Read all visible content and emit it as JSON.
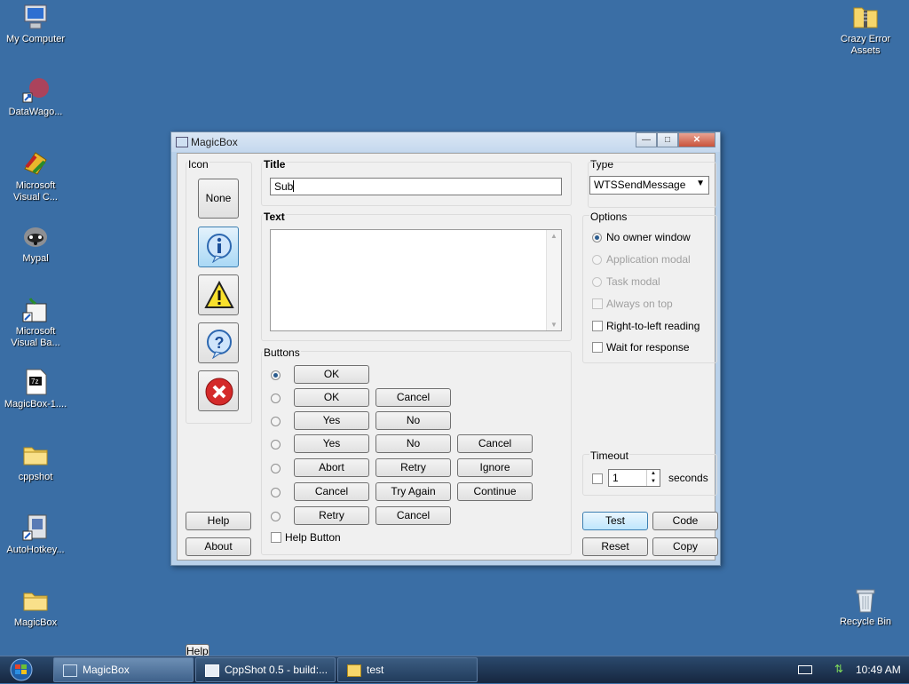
{
  "desktop": {
    "icons": [
      {
        "label": "My Computer",
        "icon": "computer-icon"
      },
      {
        "label": "DataWago...",
        "icon": "app-shortcut-icon"
      },
      {
        "label": "Microsoft Visual C...",
        "icon": "visual-c-icon"
      },
      {
        "label": "Mypal",
        "icon": "raccoon-icon"
      },
      {
        "label": "Microsoft Visual Ba...",
        "icon": "visual-basic-icon"
      },
      {
        "label": "MagicBox-1....",
        "icon": "7z-archive-icon"
      },
      {
        "label": "cppshot",
        "icon": "folder-icon"
      },
      {
        "label": "AutoHotkey...",
        "icon": "autohotkey-icon"
      },
      {
        "label": "MagicBox",
        "icon": "folder-icon"
      },
      {
        "label": "Crazy Error Assets",
        "icon": "zip-folder-icon"
      },
      {
        "label": "Recycle Bin",
        "icon": "recycle-bin-icon"
      }
    ]
  },
  "window": {
    "title": "MagicBox",
    "icon_section": {
      "label": "Icon",
      "none_label": "None",
      "icons": [
        "information-icon",
        "warning-icon",
        "question-icon",
        "error-icon"
      ],
      "selected": "information-icon"
    },
    "title_field": {
      "label": "Title",
      "value": "Sub"
    },
    "text_field": {
      "label": "Text",
      "value": ""
    },
    "type": {
      "label": "Type",
      "selected": "WTSSendMessage"
    },
    "options": {
      "label": "Options",
      "radios": [
        {
          "label": "No owner window",
          "checked": true,
          "enabled": true
        },
        {
          "label": "Application modal",
          "checked": false,
          "enabled": false
        },
        {
          "label": "Task modal",
          "checked": false,
          "enabled": false
        }
      ],
      "checks": [
        {
          "label": "Always on top",
          "checked": false,
          "enabled": false
        },
        {
          "label": "Right-to-left reading",
          "checked": false,
          "enabled": true
        },
        {
          "label": "Wait for response",
          "checked": false,
          "enabled": true
        }
      ]
    },
    "buttons_section": {
      "label": "Buttons",
      "rows": [
        [
          "OK"
        ],
        [
          "OK",
          "Cancel"
        ],
        [
          "Yes",
          "No"
        ],
        [
          "Yes",
          "No",
          "Cancel"
        ],
        [
          "Abort",
          "Retry",
          "Ignore"
        ],
        [
          "Cancel",
          "Try Again",
          "Continue"
        ],
        [
          "Retry",
          "Cancel"
        ]
      ],
      "selected_row": 0,
      "help_button_label": "Help Button"
    },
    "timeout": {
      "label": "Timeout",
      "value": "1",
      "unit": "seconds"
    },
    "actions": {
      "help": "Help",
      "about": "About",
      "test": "Test",
      "code": "Code",
      "reset": "Reset",
      "copy": "Copy"
    }
  },
  "taskbar": {
    "items": [
      {
        "label": "MagicBox",
        "active": true
      },
      {
        "label": "CppShot 0.5 - build:...",
        "active": false
      },
      {
        "label": "test",
        "active": false
      }
    ],
    "clock": "10:49 AM"
  }
}
